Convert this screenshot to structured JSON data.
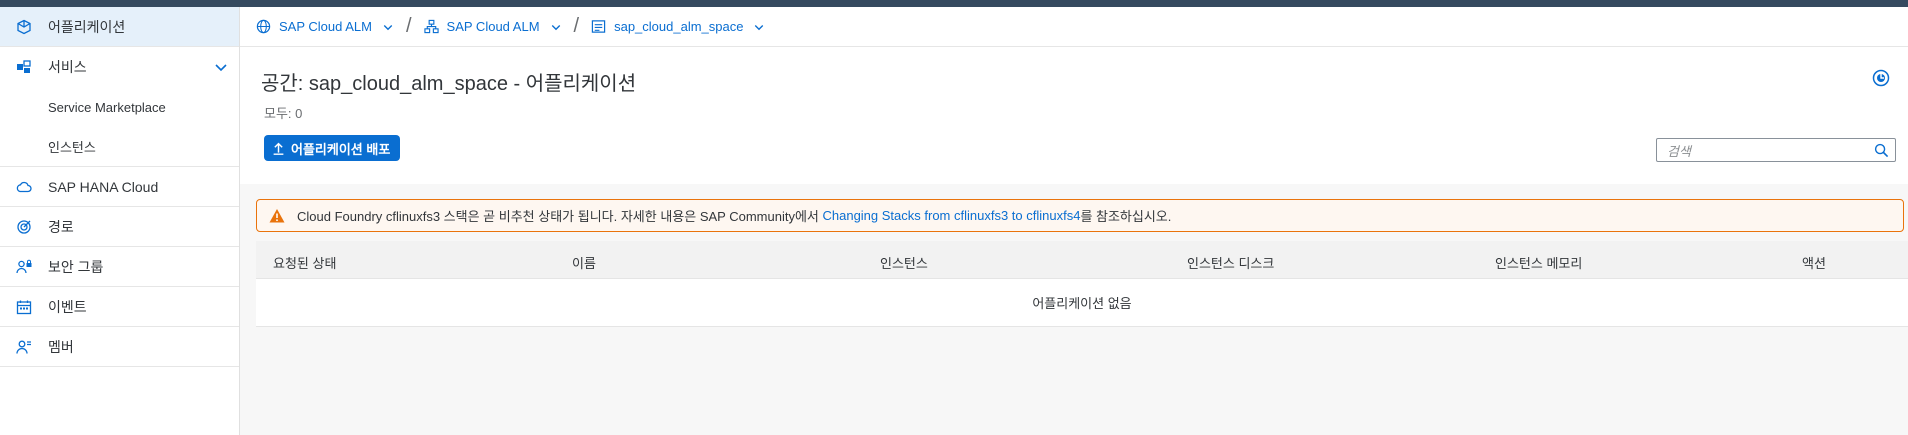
{
  "sidebar": {
    "items": [
      {
        "label": "어플리케이션",
        "icon": "cube-icon"
      },
      {
        "label": "서비스",
        "icon": "puzzle-icon"
      },
      {
        "label": "Service Marketplace"
      },
      {
        "label": "인스턴스"
      },
      {
        "label": "SAP HANA Cloud",
        "icon": "cloud-icon"
      },
      {
        "label": "경로",
        "icon": "target-icon"
      },
      {
        "label": "보안 그룹",
        "icon": "user-lock-icon"
      },
      {
        "label": "이벤트",
        "icon": "calendar-icon"
      },
      {
        "label": "멤버",
        "icon": "person-icon"
      }
    ]
  },
  "breadcrumbs": [
    {
      "label": "SAP Cloud ALM",
      "icon": "globe-icon"
    },
    {
      "label": "SAP Cloud ALM",
      "icon": "hierarchy-icon"
    },
    {
      "label": "sap_cloud_alm_space",
      "icon": "space-icon"
    }
  ],
  "page": {
    "title": "공간: sap_cloud_alm_space - 어플리케이션",
    "count": "모두: 0",
    "deploy_label": "어플리케이션 배포",
    "search_placeholder": "검색"
  },
  "warning": {
    "text_before": "Cloud Foundry cflinuxfs3 스택은 곧 비추천 상태가 됩니다. 자세한 내용은 SAP Community에서 ",
    "link": "Changing Stacks from cflinuxfs3 to cflinuxfs4",
    "text_after": "를 참조하십시오."
  },
  "table": {
    "columns": [
      "요청된 상태",
      "이름",
      "인스턴스",
      "인스턴스 디스크",
      "인스턴스 메모리",
      "액션"
    ],
    "empty_text": "어플리케이션 없음"
  },
  "colors": {
    "accent": "#0a6ed1",
    "warning": "#e9730c",
    "topbar": "#354a5f"
  }
}
